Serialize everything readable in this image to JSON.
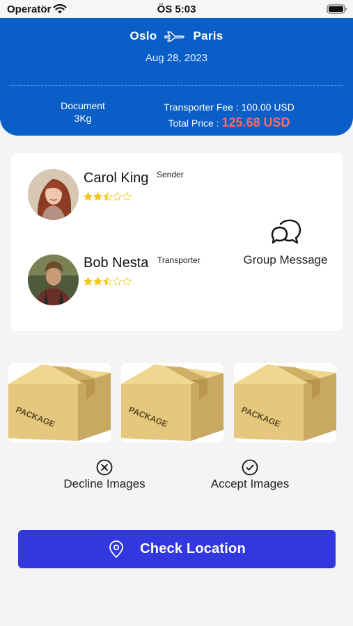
{
  "status_bar": {
    "carrier": "Operatör",
    "time": "ÖS 5:03"
  },
  "trip": {
    "from": "Oslo",
    "to": "Paris",
    "date": "Aug 28, 2023",
    "package_type": "Document",
    "package_weight": "3Kg",
    "fee_label": "Transporter Fee : 100.00 USD",
    "total_label": "Total Price :",
    "total_value": "125.68 USD"
  },
  "parties": [
    {
      "name": "Carol King",
      "role": "Sender",
      "rating": 2.5
    },
    {
      "name": "Bob Nesta",
      "role": "Transporter",
      "rating": 2.5
    }
  ],
  "group_message_label": "Group Message",
  "images": [
    {
      "label": "PACKAGE"
    },
    {
      "label": "PACKAGE"
    },
    {
      "label": "PACKAGE"
    }
  ],
  "actions": {
    "decline_label": "Decline Images",
    "accept_label": "Accept Images"
  },
  "check_location_label": "Check Location",
  "colors": {
    "header": "#0a5ec8",
    "total_price": "#ff6b5e",
    "button": "#3237e0",
    "star": "#f5c518"
  }
}
